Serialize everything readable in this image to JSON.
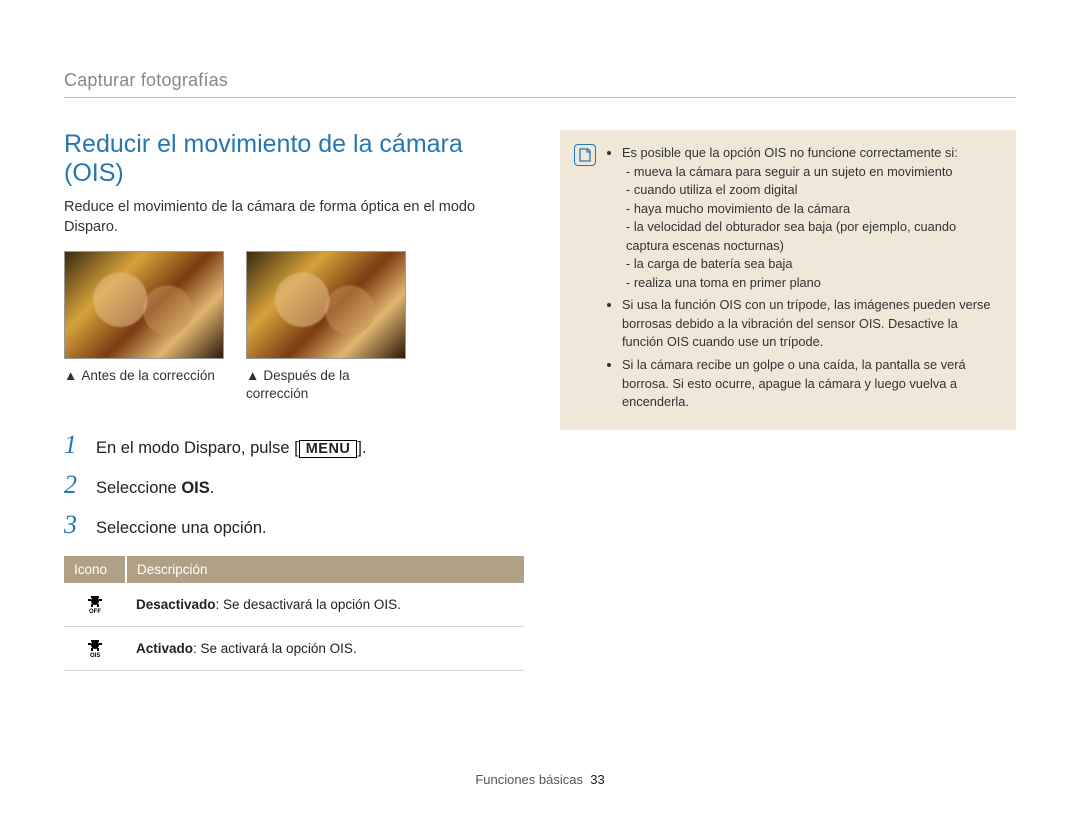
{
  "breadcrumb": "Capturar fotografías",
  "title": "Reducir el movimiento de la cámara (OIS)",
  "intro": "Reduce el movimiento de la cámara de forma óptica en el modo Disparo.",
  "captions": {
    "before": "Antes de la corrección",
    "after": "Después de la corrección"
  },
  "steps": [
    {
      "num": "1",
      "prefix": "En el modo Disparo, pulse [",
      "button": "MENU",
      "suffix": "]."
    },
    {
      "num": "2",
      "text_prefix": "Seleccione ",
      "bold": "OIS",
      "text_suffix": "."
    },
    {
      "num": "3",
      "text": "Seleccione una opción."
    }
  ],
  "table": {
    "headers": {
      "icon": "Icono",
      "desc": "Descripción"
    },
    "rows": [
      {
        "icon": "ois-off",
        "bold": "Desactivado",
        "rest": ": Se desactivará la opción OIS."
      },
      {
        "icon": "ois-on",
        "bold": "Activado",
        "rest": ": Se activará la opción OIS."
      }
    ]
  },
  "note": {
    "items": [
      {
        "text": "Es posible que la opción OIS no funcione correctamente si:",
        "sub": [
          "mueva la cámara para seguir a un sujeto en movimiento",
          "cuando utiliza el zoom digital",
          "haya mucho movimiento de la cámara",
          "la velocidad del obturador sea baja (por ejemplo, cuando captura escenas nocturnas)",
          "la carga de batería sea baja",
          "realiza una toma en primer plano"
        ]
      },
      {
        "text": "Si usa la función OIS con un trípode, las imágenes pueden verse borrosas debido a la vibración del sensor OIS. Desactive la función OIS cuando use un trípode."
      },
      {
        "text": "Si la cámara recibe un golpe o una caída, la pantalla se verá borrosa. Si esto ocurre, apague la cámara y luego vuelva a encenderla."
      }
    ]
  },
  "footer": {
    "section": "Funciones básicas",
    "page": "33"
  }
}
